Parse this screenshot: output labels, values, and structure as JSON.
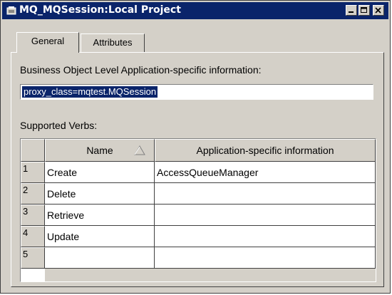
{
  "window": {
    "title": "MQ_MQSession:Local Project",
    "title_bar_color": "#0a246a",
    "icon": "database-icon",
    "controls": [
      "minimize-icon",
      "maximize-icon",
      "close-icon"
    ]
  },
  "tabs": [
    {
      "label": "General",
      "active": true
    },
    {
      "label": "Attributes",
      "active": false
    }
  ],
  "general": {
    "bo_label": "Business Object Level Application-specific information:",
    "bo_value": "proxy_class=mqtest.MQSession",
    "verbs_label": "Supported Verbs:",
    "table": {
      "columns": [
        "Name",
        "Application-specific information"
      ],
      "sort_icon": "sort-ascending-icon",
      "rows": [
        {
          "num": "1",
          "name": "Create",
          "info": "AccessQueueManager"
        },
        {
          "num": "2",
          "name": "Delete",
          "info": ""
        },
        {
          "num": "3",
          "name": "Retrieve",
          "info": ""
        },
        {
          "num": "4",
          "name": "Update",
          "info": ""
        },
        {
          "num": "5",
          "name": "",
          "info": ""
        }
      ]
    }
  }
}
